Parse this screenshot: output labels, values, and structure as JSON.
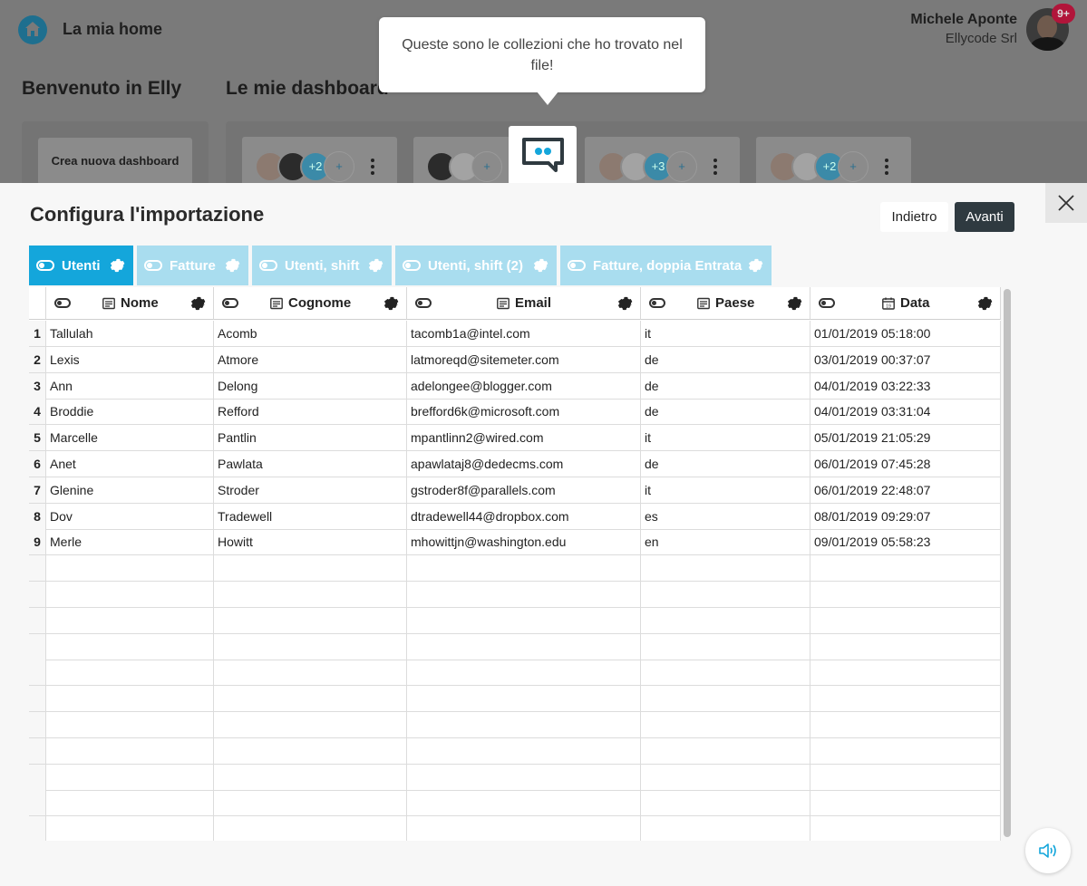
{
  "header": {
    "home_title": "La mia home",
    "user_name": "Michele Aponte",
    "user_company": "Ellycode Srl",
    "notification_count": "9+"
  },
  "background": {
    "welcome": "Benvenuto in Elly",
    "dashboards_title": "Le mie dashboard",
    "create_dashboard": "Crea nuova dashboard",
    "cards": [
      {
        "extra_users": "+2"
      },
      {
        "extra_users": ""
      },
      {
        "extra_users": "+3"
      },
      {
        "extra_users": "+2"
      }
    ]
  },
  "tooltip": {
    "text": "Queste sono le collezioni che ho trovato nel file!"
  },
  "modal": {
    "title": "Configura l'importazione",
    "back_label": "Indietro",
    "next_label": "Avanti",
    "colors": {
      "active_tab": "#14a6db",
      "inactive_tab": "#a9ddef",
      "primary_button": "#2f3a40"
    },
    "tabs": [
      {
        "label": "Utenti",
        "active": true
      },
      {
        "label": "Fatture",
        "active": false
      },
      {
        "label": "Utenti, shift",
        "active": false
      },
      {
        "label": "Utenti, shift (2)",
        "active": false
      },
      {
        "label": "Fatture, doppia Entrata",
        "active": false
      }
    ],
    "columns": [
      {
        "label": "Nome",
        "type_icon": "text-icon"
      },
      {
        "label": "Cognome",
        "type_icon": "text-icon"
      },
      {
        "label": "Email",
        "type_icon": "text-icon"
      },
      {
        "label": "Paese",
        "type_icon": "text-icon"
      },
      {
        "label": "Data",
        "type_icon": "calendar-icon"
      }
    ],
    "rows": [
      {
        "n": "1",
        "nome": "Tallulah",
        "cognome": "Acomb",
        "email": "tacomb1a@intel.com",
        "paese": "it",
        "data": "01/01/2019 05:18:00"
      },
      {
        "n": "2",
        "nome": "Lexis",
        "cognome": "Atmore",
        "email": "latmoreqd@sitemeter.com",
        "paese": "de",
        "data": "03/01/2019 00:37:07"
      },
      {
        "n": "3",
        "nome": "Ann",
        "cognome": "Delong",
        "email": "adelongee@blogger.com",
        "paese": "de",
        "data": "04/01/2019 03:22:33"
      },
      {
        "n": "4",
        "nome": "Broddie",
        "cognome": "Refford",
        "email": "brefford6k@microsoft.com",
        "paese": "de",
        "data": "04/01/2019 03:31:04"
      },
      {
        "n": "5",
        "nome": "Marcelle",
        "cognome": "Pantlin",
        "email": "mpantlinn2@wired.com",
        "paese": "it",
        "data": "05/01/2019 21:05:29"
      },
      {
        "n": "6",
        "nome": "Anet",
        "cognome": "Pawlata",
        "email": "apawlataj8@dedecms.com",
        "paese": "de",
        "data": "06/01/2019 07:45:28"
      },
      {
        "n": "7",
        "nome": "Glenine",
        "cognome": "Stroder",
        "email": "gstroder8f@parallels.com",
        "paese": "it",
        "data": "06/01/2019 22:48:07"
      },
      {
        "n": "8",
        "nome": "Dov",
        "cognome": "Tradewell",
        "email": "dtradewell44@dropbox.com",
        "paese": "es",
        "data": "08/01/2019 09:29:07"
      },
      {
        "n": "9",
        "nome": "Merle",
        "cognome": "Howitt",
        "email": "mhowittjn@washington.edu",
        "paese": "en",
        "data": "09/01/2019 05:58:23"
      }
    ]
  }
}
